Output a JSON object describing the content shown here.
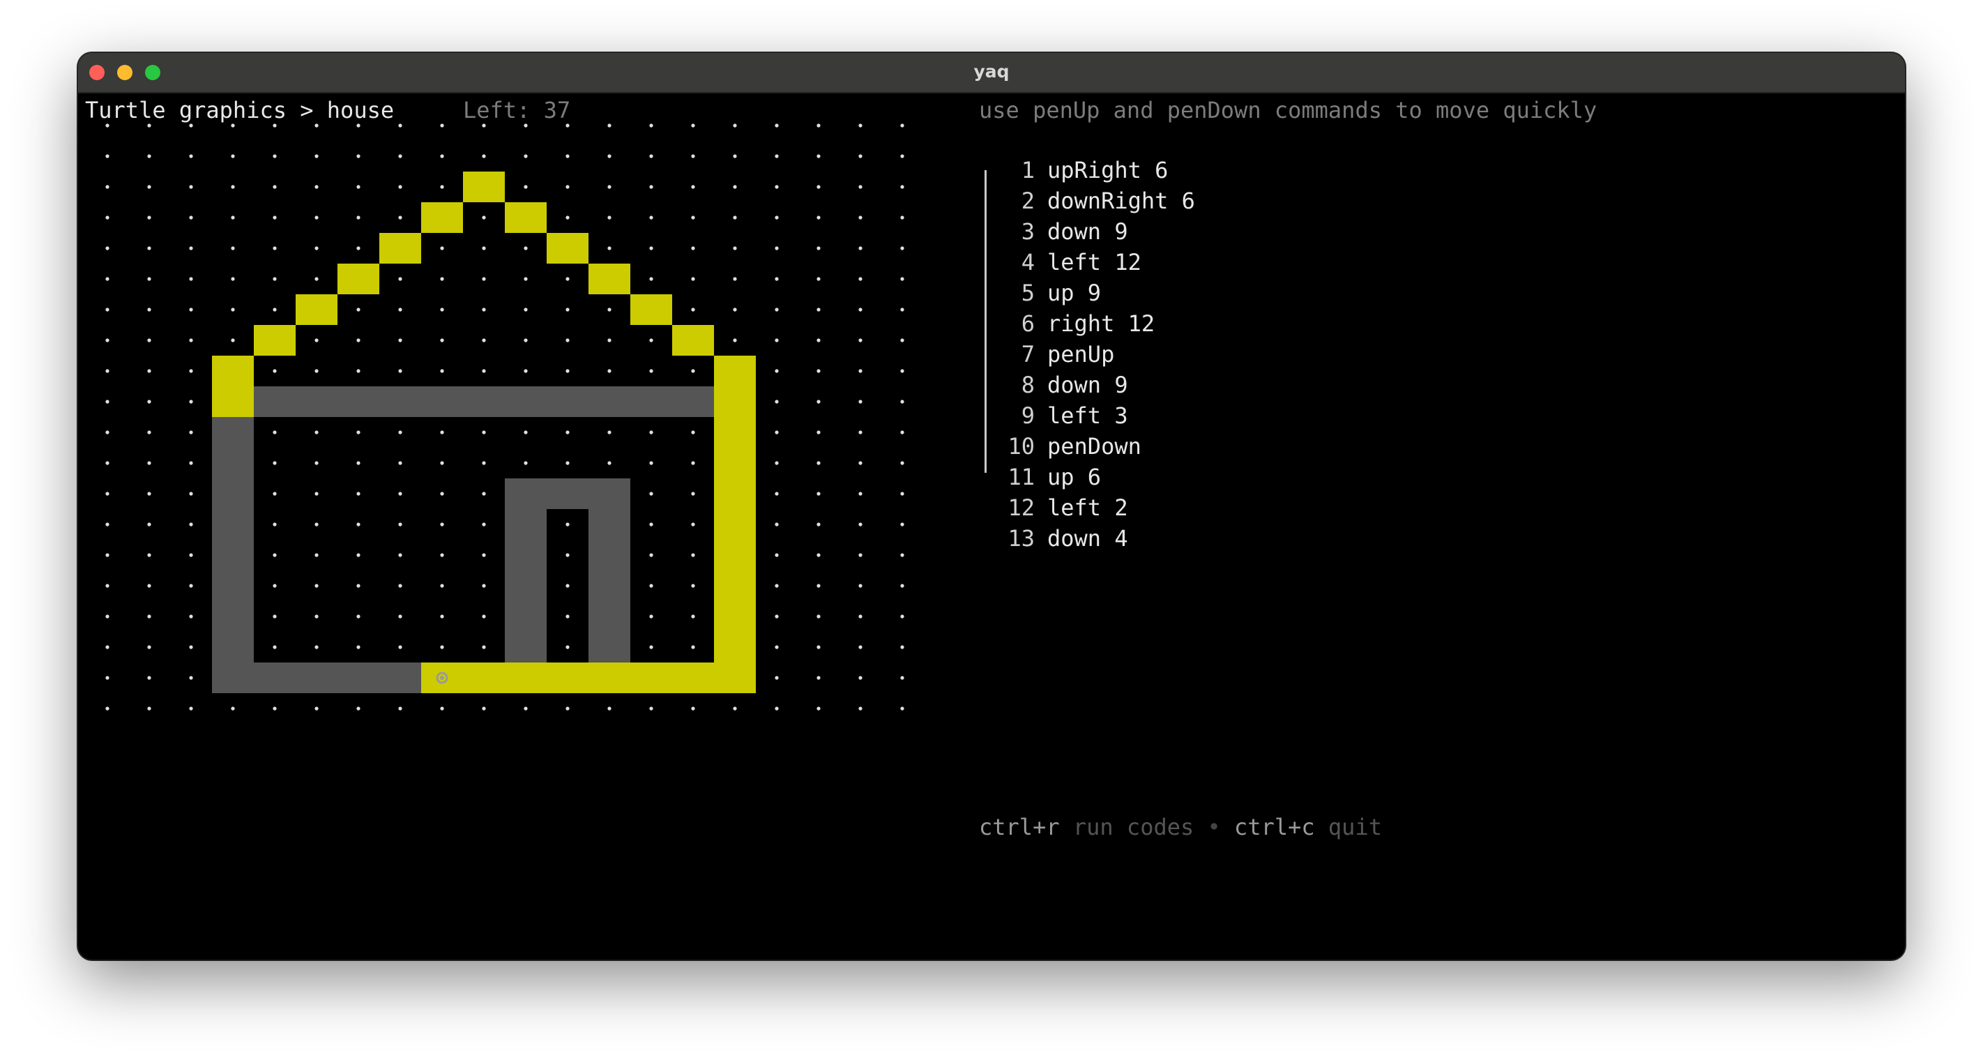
{
  "window": {
    "title": "yaq"
  },
  "header": {
    "breadcrumb": "Turtle graphics > house",
    "left_label": "Left: 37",
    "hint": "use penUp and penDown commands to move quickly"
  },
  "code": {
    "lines": [
      {
        "num": "1",
        "text": "upRight 6"
      },
      {
        "num": "2",
        "text": "downRight 6"
      },
      {
        "num": "3",
        "text": "down 9"
      },
      {
        "num": "4",
        "text": "left 12"
      },
      {
        "num": "5",
        "text": "up 9"
      },
      {
        "num": "6",
        "text": "right 12"
      },
      {
        "num": "7",
        "text": "penUp"
      },
      {
        "num": "8",
        "text": "down 9"
      },
      {
        "num": "9",
        "text": "left 3"
      },
      {
        "num": "10",
        "text": "penDown"
      },
      {
        "num": "11",
        "text": "up 6"
      },
      {
        "num": "12",
        "text": "left 2"
      },
      {
        "num": "13",
        "text": "down 4"
      }
    ]
  },
  "footer": {
    "run_key": "ctrl+r",
    "run_label": "run codes",
    "separator": "•",
    "quit_key": "ctrl+c",
    "quit_label": "quit"
  },
  "canvas": {
    "cols": 20,
    "rows": 20,
    "colors": {
      "target": "#cccc00",
      "drawn": "#555555",
      "dot": "#e0e0e0",
      "turtle": "#9a9a9a"
    },
    "target_cells": [
      [
        9,
        2
      ],
      [
        8,
        3
      ],
      [
        10,
        3
      ],
      [
        7,
        4
      ],
      [
        11,
        4
      ],
      [
        6,
        5
      ],
      [
        12,
        5
      ],
      [
        5,
        6
      ],
      [
        13,
        6
      ],
      [
        4,
        7
      ],
      [
        14,
        7
      ],
      [
        3,
        8
      ],
      [
        15,
        8
      ],
      [
        3,
        9
      ]
    ],
    "drawn_cells": [
      [
        4,
        9
      ],
      [
        5,
        9
      ],
      [
        6,
        9
      ],
      [
        7,
        9
      ],
      [
        8,
        9
      ],
      [
        9,
        9
      ],
      [
        10,
        9
      ],
      [
        11,
        9
      ],
      [
        12,
        9
      ],
      [
        13,
        9
      ],
      [
        14,
        9
      ],
      [
        3,
        10
      ],
      [
        3,
        11
      ],
      [
        3,
        12
      ],
      [
        3,
        13
      ],
      [
        3,
        14
      ],
      [
        3,
        15
      ],
      [
        3,
        16
      ],
      [
        3,
        17
      ],
      [
        3,
        18
      ],
      [
        4,
        18
      ],
      [
        5,
        18
      ],
      [
        6,
        18
      ],
      [
        7,
        18
      ],
      [
        10,
        12
      ],
      [
        11,
        12
      ],
      [
        12,
        12
      ],
      [
        10,
        13
      ],
      [
        10,
        14
      ],
      [
        10,
        15
      ],
      [
        10,
        16
      ],
      [
        10,
        17
      ],
      [
        12,
        13
      ],
      [
        12,
        14
      ],
      [
        12,
        15
      ],
      [
        12,
        16
      ],
      [
        12,
        17
      ]
    ],
    "target_path_cells": [
      [
        15,
        9
      ],
      [
        15,
        10
      ],
      [
        15,
        11
      ],
      [
        15,
        12
      ],
      [
        15,
        13
      ],
      [
        15,
        14
      ],
      [
        15,
        15
      ],
      [
        15,
        16
      ],
      [
        15,
        17
      ],
      [
        8,
        18
      ],
      [
        9,
        18
      ],
      [
        10,
        18
      ],
      [
        11,
        18
      ],
      [
        12,
        18
      ],
      [
        13,
        18
      ],
      [
        14,
        18
      ],
      [
        15,
        18
      ]
    ],
    "turtle": [
      8,
      18
    ]
  }
}
